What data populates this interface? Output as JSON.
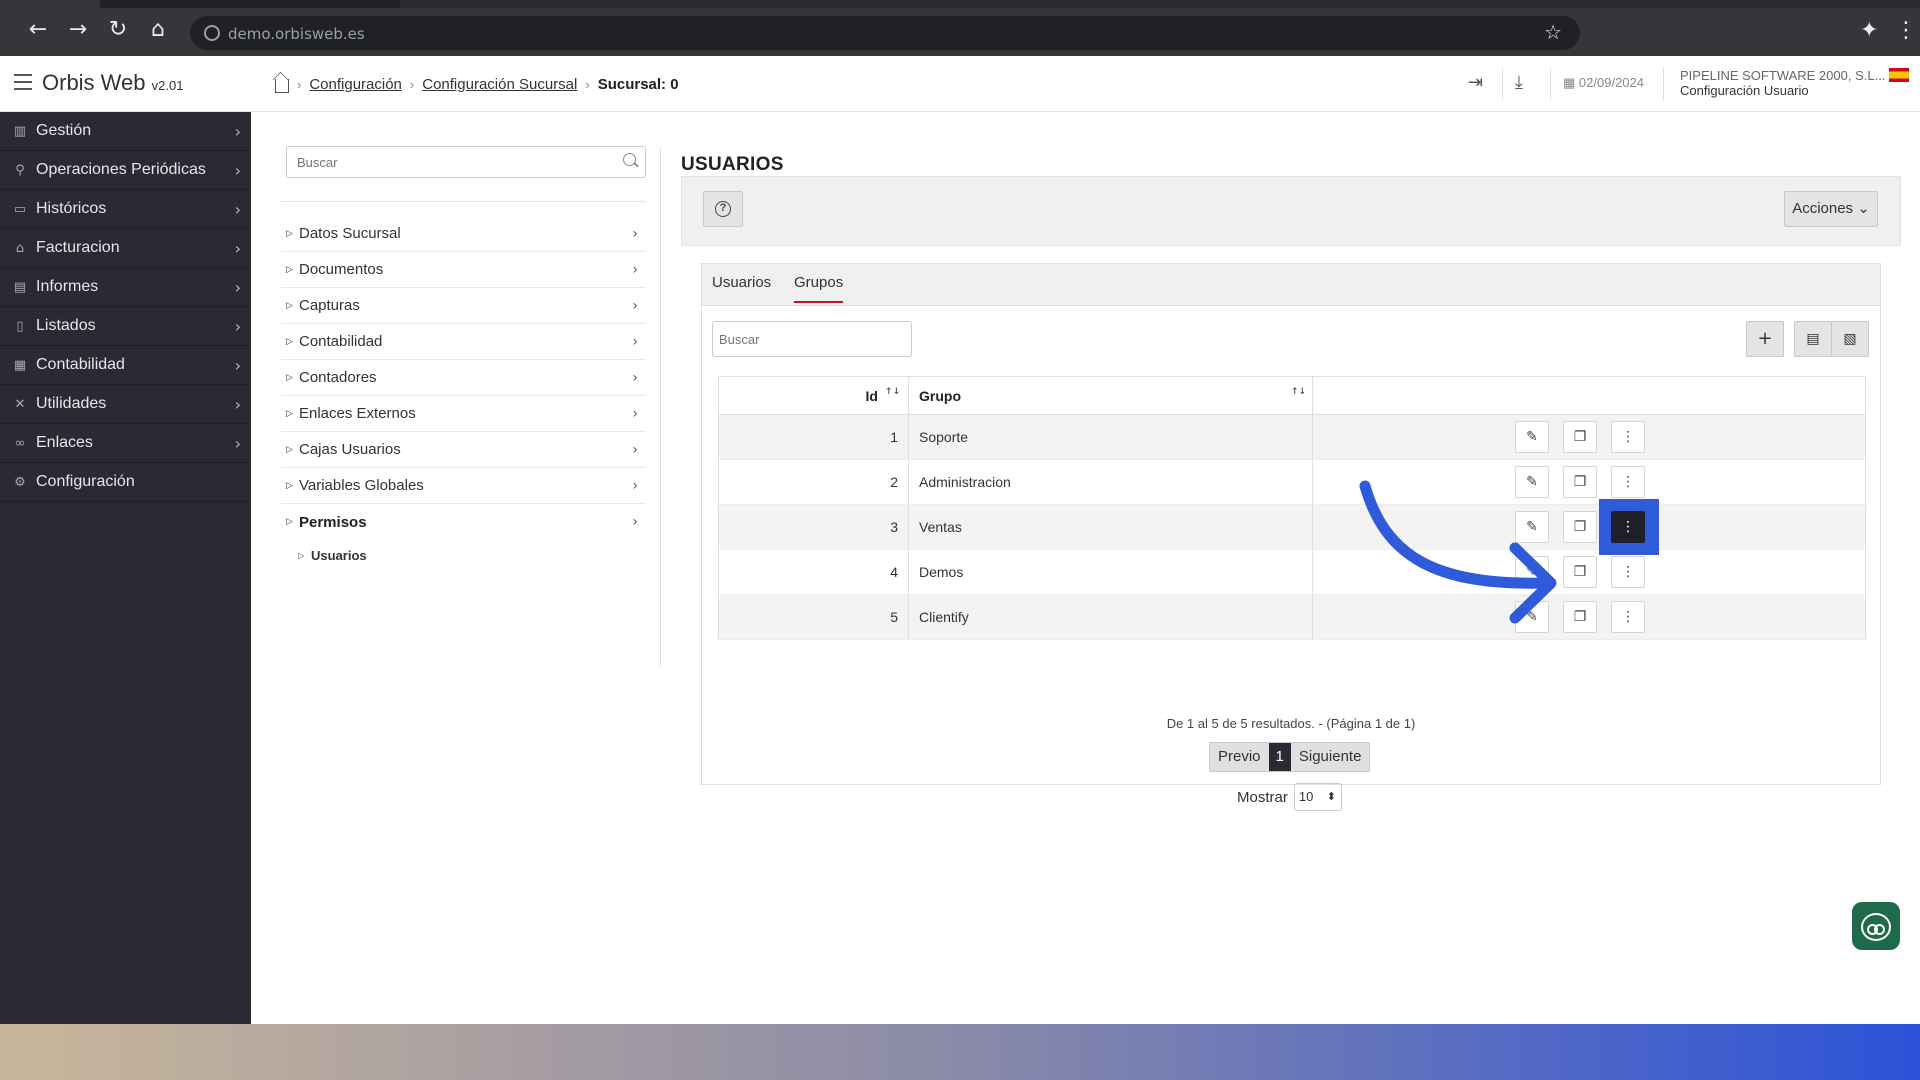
{
  "browser": {
    "url": "demo.orbisweb.es"
  },
  "header": {
    "app_name": "Orbis Web",
    "version": "v2.01",
    "breadcrumb": [
      "Configuración",
      "Configuración Sucursal"
    ],
    "breadcrumb_current": "Sucursal: 0",
    "date": "02/09/2024",
    "company": "PIPELINE SOFTWARE 2000, S.L...",
    "user_config": "Configuración Usuario"
  },
  "sidebar": {
    "items": [
      {
        "label": "Gestión",
        "icon": "building-icon"
      },
      {
        "label": "Operaciones Periódicas",
        "icon": "share-icon"
      },
      {
        "label": "Históricos",
        "icon": "folder-icon"
      },
      {
        "label": "Facturacion",
        "icon": "bank-icon"
      },
      {
        "label": "Informes",
        "icon": "report-icon"
      },
      {
        "label": "Listados",
        "icon": "list-icon"
      },
      {
        "label": "Contabilidad",
        "icon": "chart-icon"
      },
      {
        "label": "Utilidades",
        "icon": "tools-icon"
      },
      {
        "label": "Enlaces",
        "icon": "link-icon"
      },
      {
        "label": "Configuración",
        "icon": "gear-icon"
      }
    ]
  },
  "tree": {
    "search_placeholder": "Buscar",
    "items": [
      {
        "label": "Datos Sucursal"
      },
      {
        "label": "Documentos"
      },
      {
        "label": "Capturas"
      },
      {
        "label": "Contabilidad"
      },
      {
        "label": "Contadores"
      },
      {
        "label": "Enlaces Externos"
      },
      {
        "label": "Cajas Usuarios"
      },
      {
        "label": "Variables Globales"
      },
      {
        "label": "Permisos"
      }
    ],
    "sub_item": "Usuarios"
  },
  "main": {
    "title": "USUARIOS",
    "acciones_label": "Acciones ⌄",
    "help_label": "?",
    "tabs": [
      "Usuarios",
      "Grupos"
    ],
    "active_tab": "Grupos",
    "search_placeholder": "Buscar",
    "table": {
      "columns": [
        "Id",
        "Grupo"
      ],
      "rows": [
        {
          "id": "1",
          "grupo": "Soporte"
        },
        {
          "id": "2",
          "grupo": "Administracion"
        },
        {
          "id": "3",
          "grupo": "Ventas"
        },
        {
          "id": "4",
          "grupo": "Demos"
        },
        {
          "id": "5",
          "grupo": "Clientify"
        }
      ]
    },
    "pager_info": "De 1 al 5 de 5 resultados. - (Página 1 de 1)",
    "prev_label": "Previo",
    "page_number": "1",
    "next_label": "Siguiente",
    "show_label": "Mostrar",
    "page_size": "10"
  },
  "colors": {
    "sidebar_bg": "#2a2a35",
    "accent_red": "#c8102e",
    "highlight_blue": "#2f5bdb"
  }
}
